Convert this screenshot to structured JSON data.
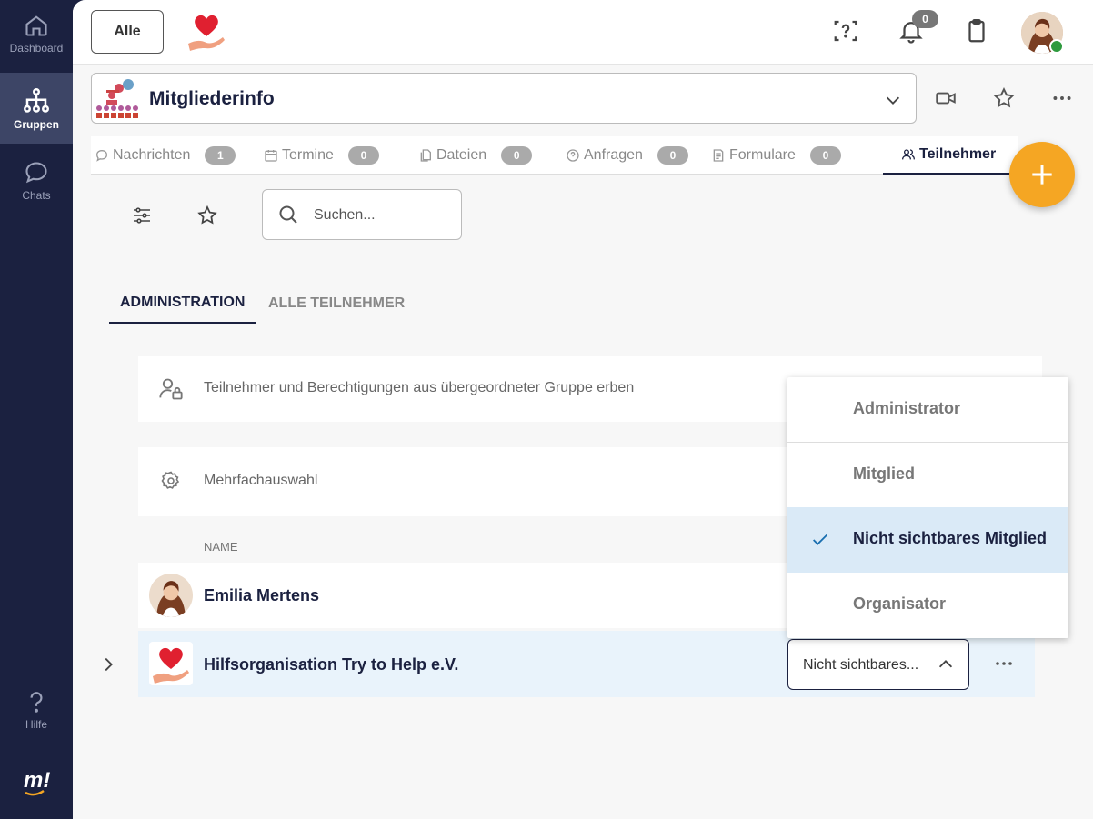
{
  "sidebar": {
    "items": [
      {
        "label": "Dashboard",
        "icon": "home-icon"
      },
      {
        "label": "Gruppen",
        "icon": "hierarchy-icon"
      },
      {
        "label": "Chats",
        "icon": "chat-bubble-icon"
      },
      {
        "label": "Hilfe",
        "icon": "question-icon"
      }
    ],
    "logo_icon": "m-logo-icon"
  },
  "topbar": {
    "alle_label": "Alle",
    "notifications_count": "0"
  },
  "group": {
    "title": "Mitgliederinfo"
  },
  "tabs": [
    {
      "label": "Nachrichten",
      "count": "1",
      "icon": "message-icon"
    },
    {
      "label": "Termine",
      "count": "0",
      "icon": "calendar-icon"
    },
    {
      "label": "Dateien",
      "count": "0",
      "icon": "files-icon"
    },
    {
      "label": "Anfragen",
      "count": "0",
      "icon": "question-circle-icon"
    },
    {
      "label": "Formulare",
      "count": "0",
      "icon": "form-icon"
    },
    {
      "label": "Teilnehmer",
      "icon": "people-icon"
    }
  ],
  "toolbar": {
    "search_placeholder": "Suchen..."
  },
  "subtabs": [
    "ADMINISTRATION",
    "ALLE TEILNEHMER"
  ],
  "settings": {
    "inherit_label": "Teilnehmer und Berechtigungen aus übergeordneter Gruppe erben",
    "multiselect_label": "Mehrfachauswahl"
  },
  "members": {
    "column_name": "NAME",
    "rows": [
      {
        "name": "Emilia Mertens"
      },
      {
        "name": "Hilfsorganisation Try to Help e.V.",
        "role": "Nicht sichtbares..."
      }
    ]
  },
  "role_dropdown": {
    "options": [
      "Administrator",
      "Mitglied",
      "Nicht sichtbares Mitglied",
      "Organisator"
    ],
    "selected": "Nicht sichtbares Mitglied"
  },
  "colors": {
    "sidebar_bg": "#1b2140",
    "accent": "#f5a623",
    "selected_bg": "#daeaf7"
  }
}
